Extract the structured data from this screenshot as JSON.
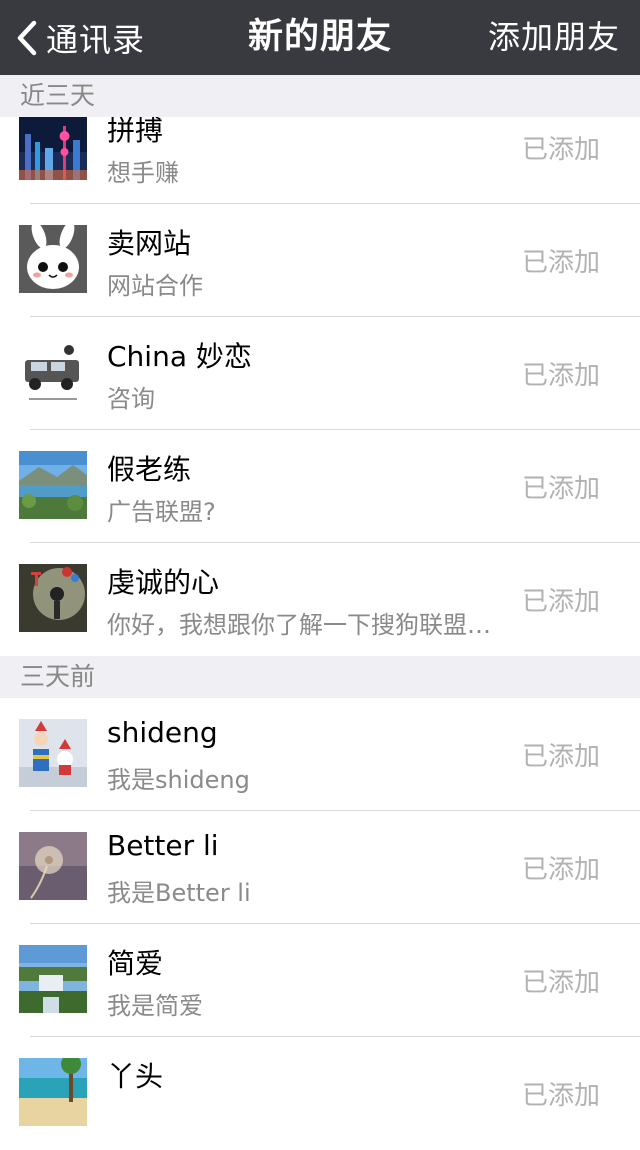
{
  "nav": {
    "back_label": "通讯录",
    "title": "新的朋友",
    "right_label": "添加朋友"
  },
  "sections": [
    {
      "header": "近三天",
      "items": [
        {
          "name": "拼搏",
          "sub": "想手赚",
          "status": "已添加",
          "avatar": "city-skyline-avatar"
        },
        {
          "name": "卖网站",
          "sub": "网站合作",
          "status": "已添加",
          "avatar": "cartoon-rabbit-avatar"
        },
        {
          "name": "China 妙恋",
          "sub": "咨询",
          "status": "已添加",
          "avatar": "suv-car-avatar"
        },
        {
          "name": "假老练",
          "sub": "广告联盟?",
          "status": "已添加",
          "avatar": "lake-mountain-avatar"
        },
        {
          "name": "虔诚的心",
          "sub": "你好，我想跟你了解一下搜狗联盟的广告",
          "status": "已添加",
          "avatar": "girl-balloons-avatar"
        }
      ]
    },
    {
      "header": "三天前",
      "items": [
        {
          "name": "shideng",
          "sub": "我是shideng",
          "status": "已添加",
          "avatar": "christmas-toys-avatar"
        },
        {
          "name": "Better li",
          "sub": "我是Better li",
          "status": "已添加",
          "avatar": "dandelion-avatar"
        },
        {
          "name": "简爱",
          "sub": "我是简爱",
          "status": "已添加",
          "avatar": "waterfall-avatar"
        },
        {
          "name": "丫头",
          "sub": "",
          "status": "已添加",
          "avatar": "beach-avatar"
        }
      ]
    }
  ]
}
